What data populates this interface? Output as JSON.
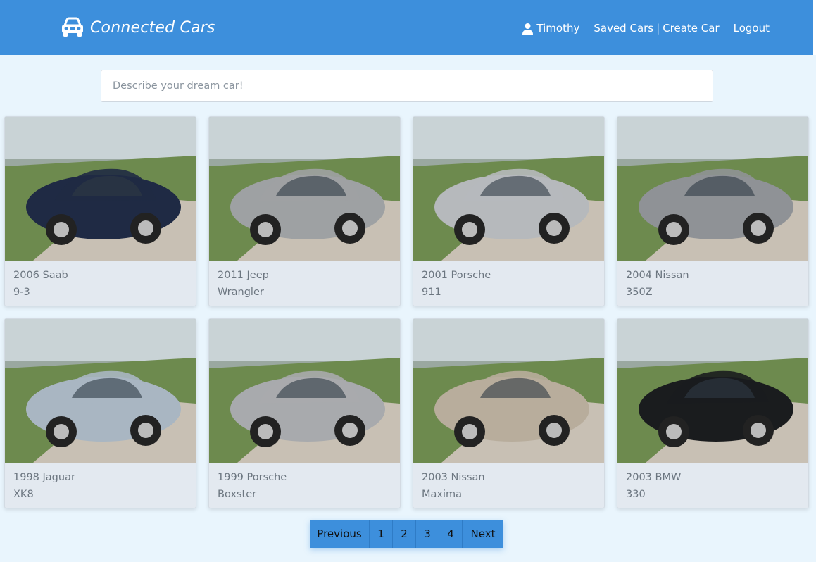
{
  "brand": {
    "title": "Connected Cars",
    "icon": "car-icon"
  },
  "nav": {
    "user_name": "Timothy",
    "user_icon": "user-icon",
    "saved_cars": "Saved Cars",
    "separator": "|",
    "create_car": "Create Car",
    "logout": "Logout"
  },
  "search": {
    "placeholder": "Describe your dream car!",
    "value": ""
  },
  "cars": [
    {
      "year_make": "2006 Saab",
      "model": "9-3"
    },
    {
      "year_make": "2011 Jeep",
      "model": "Wrangler"
    },
    {
      "year_make": "2001 Porsche",
      "model": "911"
    },
    {
      "year_make": "2004 Nissan",
      "model": "350Z"
    },
    {
      "year_make": "1998 Jaguar",
      "model": "XK8"
    },
    {
      "year_make": "1999 Porsche",
      "model": "Boxster"
    },
    {
      "year_make": "2003 Nissan",
      "model": "Maxima"
    },
    {
      "year_make": "2003 BMW",
      "model": "330"
    }
  ],
  "pagination": {
    "previous": "Previous",
    "pages": [
      "1",
      "2",
      "3",
      "4"
    ],
    "next": "Next"
  },
  "colors": {
    "navbar": "#3d8fdc",
    "page_background": "#e9f5fd",
    "card_background": "#e3e9f0",
    "card_text": "#6c7680"
  }
}
